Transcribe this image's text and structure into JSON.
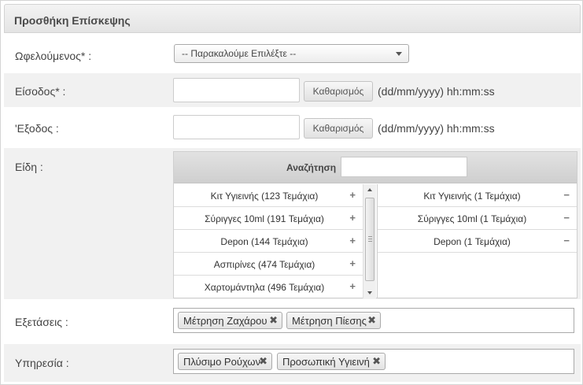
{
  "form": {
    "title": "Προσθήκη Επίσκεψης",
    "beneficiary": {
      "label": "Ωφελούμενος* :",
      "selected": "-- Παρακαλούμε Επιλέξτε --"
    },
    "entry": {
      "label": "Είσοδος* :",
      "value": "",
      "clear_label": "Καθαρισμός",
      "format": "(dd/mm/yyyy) hh:mm:ss"
    },
    "exit": {
      "label": "'Εξοδος :",
      "value": "",
      "clear_label": "Καθαρισμός",
      "format": "(dd/mm/yyyy) hh:mm:ss"
    },
    "items": {
      "label": "Είδη :",
      "search_label": "Αναζήτηση",
      "search_value": "",
      "available": [
        {
          "text": "Κιτ Υγιεινής (123 Τεμάχια)",
          "op": "+"
        },
        {
          "text": "Σύριγγες 10ml (191 Τεμάχια)",
          "op": "+"
        },
        {
          "text": "Depon (144 Τεμάχια)",
          "op": "+"
        },
        {
          "text": "Ασπιρίνες (474 Τεμάχια)",
          "op": "+"
        },
        {
          "text": "Χαρτομάντηλα (496 Τεμάχια)",
          "op": "+"
        }
      ],
      "selected": [
        {
          "text": "Κιτ Υγιεινής (1 Τεμάχια)",
          "op": "−"
        },
        {
          "text": "Σύριγγες 10ml (1 Τεμάχια)",
          "op": "−"
        },
        {
          "text": "Depon (1 Τεμάχια)",
          "op": "−"
        }
      ]
    },
    "exams": {
      "label": "Εξετάσεις :",
      "tokens": [
        "Μέτρηση Ζαχάρου",
        "Μέτρηση Πίεσης"
      ],
      "remove_glyph": "✖"
    },
    "service": {
      "label": "Υπηρεσία :",
      "tokens": [
        "Πλύσιμο Ρούχων",
        "Προσωπική Υγιεινή"
      ],
      "remove_glyph": "✖"
    }
  }
}
